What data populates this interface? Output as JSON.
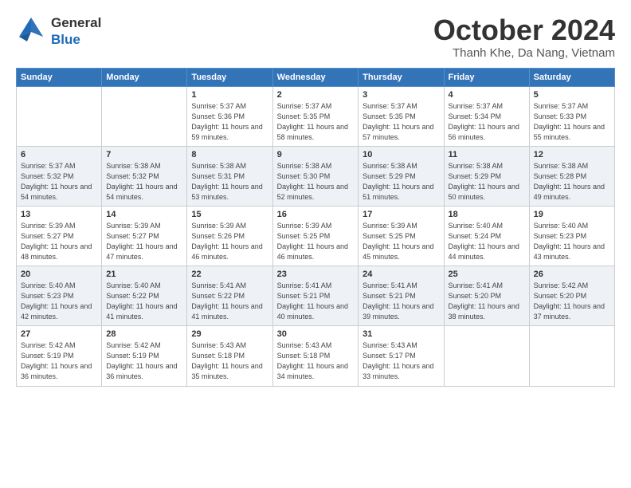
{
  "header": {
    "logo_general": "General",
    "logo_blue": "Blue",
    "month_title": "October 2024",
    "location": "Thanh Khe, Da Nang, Vietnam"
  },
  "days_of_week": [
    "Sunday",
    "Monday",
    "Tuesday",
    "Wednesday",
    "Thursday",
    "Friday",
    "Saturday"
  ],
  "weeks": [
    [
      {
        "day": "",
        "info": ""
      },
      {
        "day": "",
        "info": ""
      },
      {
        "day": "1",
        "info": "Sunrise: 5:37 AM\nSunset: 5:36 PM\nDaylight: 11 hours and 59 minutes."
      },
      {
        "day": "2",
        "info": "Sunrise: 5:37 AM\nSunset: 5:35 PM\nDaylight: 11 hours and 58 minutes."
      },
      {
        "day": "3",
        "info": "Sunrise: 5:37 AM\nSunset: 5:35 PM\nDaylight: 11 hours and 57 minutes."
      },
      {
        "day": "4",
        "info": "Sunrise: 5:37 AM\nSunset: 5:34 PM\nDaylight: 11 hours and 56 minutes."
      },
      {
        "day": "5",
        "info": "Sunrise: 5:37 AM\nSunset: 5:33 PM\nDaylight: 11 hours and 55 minutes."
      }
    ],
    [
      {
        "day": "6",
        "info": "Sunrise: 5:37 AM\nSunset: 5:32 PM\nDaylight: 11 hours and 54 minutes."
      },
      {
        "day": "7",
        "info": "Sunrise: 5:38 AM\nSunset: 5:32 PM\nDaylight: 11 hours and 54 minutes."
      },
      {
        "day": "8",
        "info": "Sunrise: 5:38 AM\nSunset: 5:31 PM\nDaylight: 11 hours and 53 minutes."
      },
      {
        "day": "9",
        "info": "Sunrise: 5:38 AM\nSunset: 5:30 PM\nDaylight: 11 hours and 52 minutes."
      },
      {
        "day": "10",
        "info": "Sunrise: 5:38 AM\nSunset: 5:29 PM\nDaylight: 11 hours and 51 minutes."
      },
      {
        "day": "11",
        "info": "Sunrise: 5:38 AM\nSunset: 5:29 PM\nDaylight: 11 hours and 50 minutes."
      },
      {
        "day": "12",
        "info": "Sunrise: 5:38 AM\nSunset: 5:28 PM\nDaylight: 11 hours and 49 minutes."
      }
    ],
    [
      {
        "day": "13",
        "info": "Sunrise: 5:39 AM\nSunset: 5:27 PM\nDaylight: 11 hours and 48 minutes."
      },
      {
        "day": "14",
        "info": "Sunrise: 5:39 AM\nSunset: 5:27 PM\nDaylight: 11 hours and 47 minutes."
      },
      {
        "day": "15",
        "info": "Sunrise: 5:39 AM\nSunset: 5:26 PM\nDaylight: 11 hours and 46 minutes."
      },
      {
        "day": "16",
        "info": "Sunrise: 5:39 AM\nSunset: 5:25 PM\nDaylight: 11 hours and 46 minutes."
      },
      {
        "day": "17",
        "info": "Sunrise: 5:39 AM\nSunset: 5:25 PM\nDaylight: 11 hours and 45 minutes."
      },
      {
        "day": "18",
        "info": "Sunrise: 5:40 AM\nSunset: 5:24 PM\nDaylight: 11 hours and 44 minutes."
      },
      {
        "day": "19",
        "info": "Sunrise: 5:40 AM\nSunset: 5:23 PM\nDaylight: 11 hours and 43 minutes."
      }
    ],
    [
      {
        "day": "20",
        "info": "Sunrise: 5:40 AM\nSunset: 5:23 PM\nDaylight: 11 hours and 42 minutes."
      },
      {
        "day": "21",
        "info": "Sunrise: 5:40 AM\nSunset: 5:22 PM\nDaylight: 11 hours and 41 minutes."
      },
      {
        "day": "22",
        "info": "Sunrise: 5:41 AM\nSunset: 5:22 PM\nDaylight: 11 hours and 41 minutes."
      },
      {
        "day": "23",
        "info": "Sunrise: 5:41 AM\nSunset: 5:21 PM\nDaylight: 11 hours and 40 minutes."
      },
      {
        "day": "24",
        "info": "Sunrise: 5:41 AM\nSunset: 5:21 PM\nDaylight: 11 hours and 39 minutes."
      },
      {
        "day": "25",
        "info": "Sunrise: 5:41 AM\nSunset: 5:20 PM\nDaylight: 11 hours and 38 minutes."
      },
      {
        "day": "26",
        "info": "Sunrise: 5:42 AM\nSunset: 5:20 PM\nDaylight: 11 hours and 37 minutes."
      }
    ],
    [
      {
        "day": "27",
        "info": "Sunrise: 5:42 AM\nSunset: 5:19 PM\nDaylight: 11 hours and 36 minutes."
      },
      {
        "day": "28",
        "info": "Sunrise: 5:42 AM\nSunset: 5:19 PM\nDaylight: 11 hours and 36 minutes."
      },
      {
        "day": "29",
        "info": "Sunrise: 5:43 AM\nSunset: 5:18 PM\nDaylight: 11 hours and 35 minutes."
      },
      {
        "day": "30",
        "info": "Sunrise: 5:43 AM\nSunset: 5:18 PM\nDaylight: 11 hours and 34 minutes."
      },
      {
        "day": "31",
        "info": "Sunrise: 5:43 AM\nSunset: 5:17 PM\nDaylight: 11 hours and 33 minutes."
      },
      {
        "day": "",
        "info": ""
      },
      {
        "day": "",
        "info": ""
      }
    ]
  ]
}
